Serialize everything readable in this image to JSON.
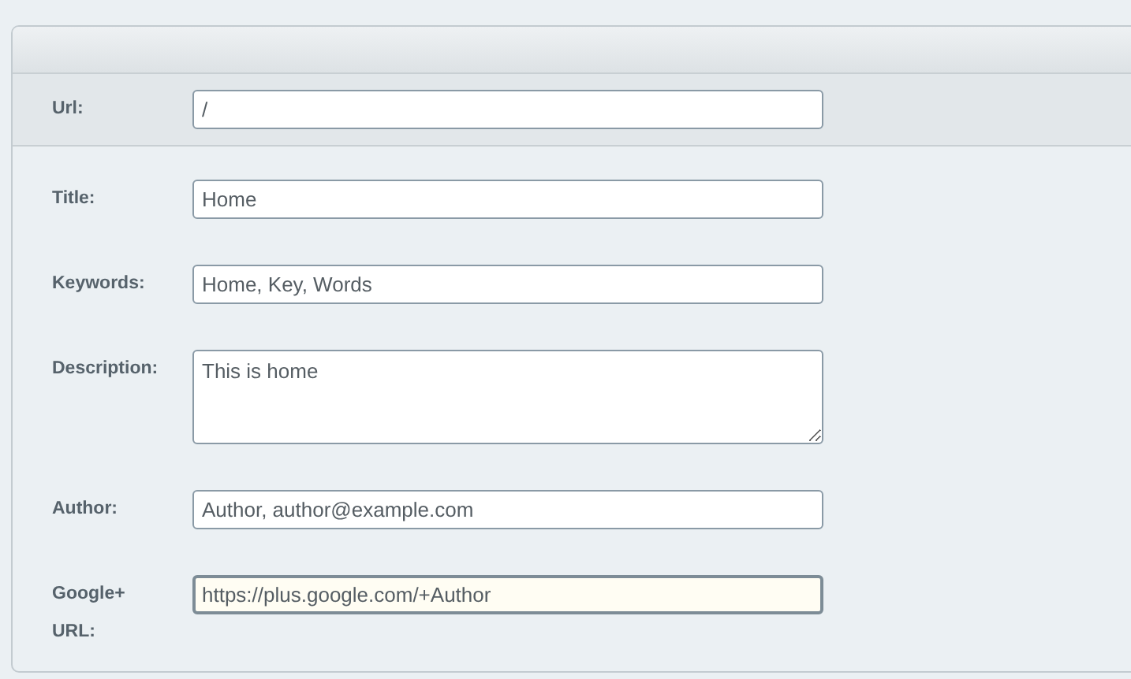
{
  "url_field": {
    "label": "Url:",
    "value": "/"
  },
  "fields": [
    {
      "kind": "input",
      "label": "Title:",
      "value": "Home",
      "focused": false
    },
    {
      "kind": "input",
      "label": "Keywords:",
      "value": "Home, Key, Words",
      "focused": false
    },
    {
      "kind": "textarea",
      "label": "Description:",
      "value": "This is home",
      "focused": false
    },
    {
      "kind": "input",
      "label": "Author:",
      "value": "Author, author@example.com",
      "focused": false
    },
    {
      "kind": "input",
      "label": "Google+ URL:",
      "value": "https://plus.google.com/+Author",
      "focused": true
    }
  ]
}
